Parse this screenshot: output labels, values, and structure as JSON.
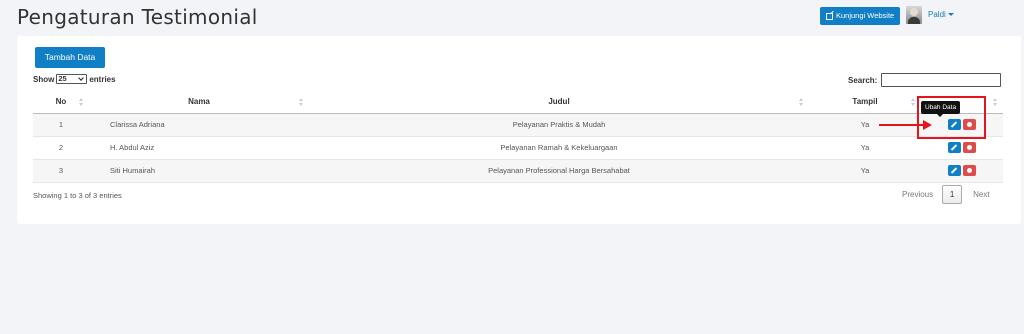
{
  "header": {
    "title": "Pengaturan Testimonial",
    "visit_label": "Kunjungi Website",
    "user_name": "Paldi"
  },
  "toolbar": {
    "add_label": "Tambah Data",
    "show_label": "Show",
    "entries_label": "entries",
    "page_length": "25",
    "search_label": "Search:"
  },
  "table": {
    "columns": [
      "No",
      "Nama",
      "Judul",
      "Tampil",
      ""
    ],
    "rows": [
      {
        "no": "1",
        "nama": "Clarissa Adriana",
        "judul": "Pelayanan Praktis & Mudah",
        "tampil": "Ya"
      },
      {
        "no": "2",
        "nama": "H. Abdul Aziz",
        "judul": "Pelayanan Ramah & Kekeluargaan",
        "tampil": "Ya"
      },
      {
        "no": "3",
        "nama": "Siti Humairah",
        "judul": "Pelayanan Professional Harga Bersahabat",
        "tampil": "Ya"
      }
    ]
  },
  "footer": {
    "info": "Showing 1 to 3 of 3 entries",
    "prev_label": "Previous",
    "current_page": "1",
    "next_label": "Next"
  },
  "tooltip": {
    "text": "Ubah Data"
  },
  "icons": {
    "visit": "external-link-icon",
    "edit": "pencil-icon",
    "delete": "delete-circle-icon",
    "caret": "caret-down-icon"
  },
  "colors": {
    "primary": "#117fc5",
    "danger": "#dd4b4b",
    "annotation": "#e3141b",
    "background": "#f2f4f8"
  }
}
